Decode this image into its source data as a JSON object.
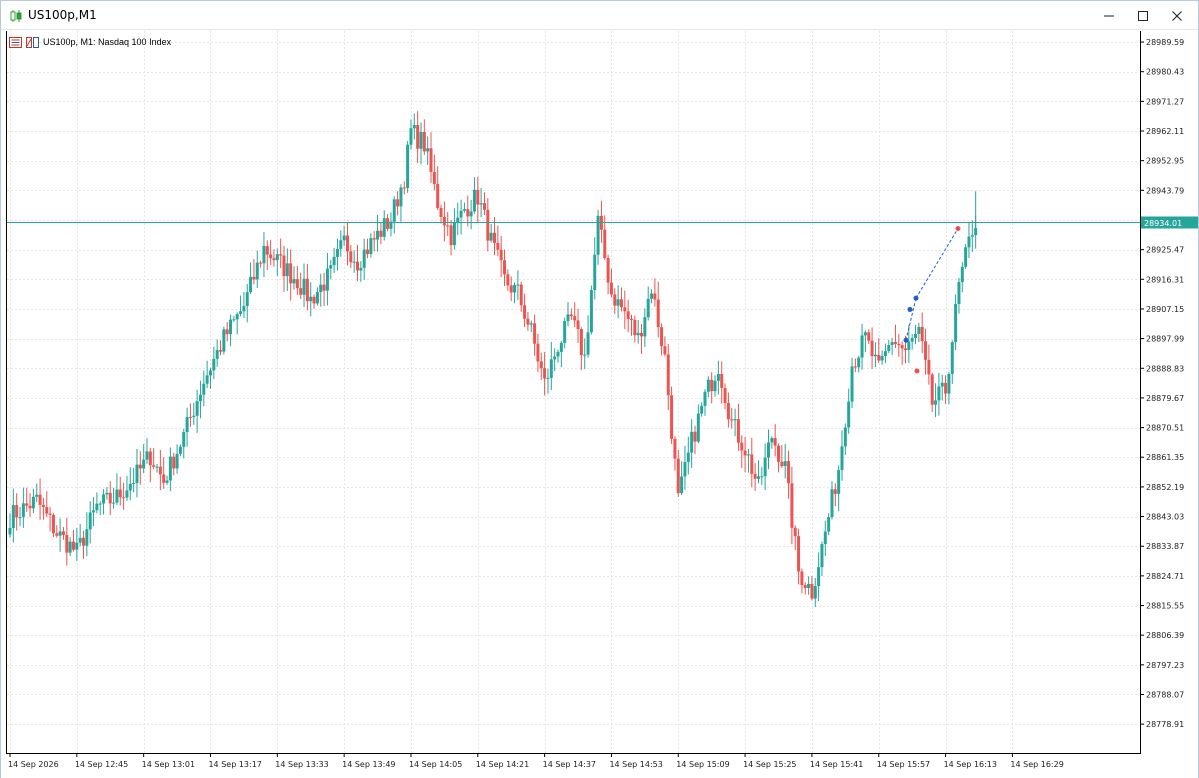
{
  "window": {
    "title": "US100p,M1",
    "icons": [
      "candles-icon",
      "minimize-icon",
      "maximize-icon",
      "close-icon"
    ]
  },
  "chart_header": {
    "label": "US100p, M1:  Nasdaq 100 Index",
    "icons": [
      "indicators-list-icon",
      "chart-type-icon"
    ]
  },
  "colors": {
    "bull": "#26a69a",
    "bear": "#ef5350",
    "grid": "#e6e6e6",
    "bid_line": "#26a69a",
    "trade_line": "#1f5fc8",
    "price_badge_bg": "#26a69a",
    "price_badge_text": "#ffffff"
  },
  "current_price": "28934.01",
  "chart_data": {
    "type": "candlestick",
    "symbol": "US100p",
    "timeframe": "M1",
    "ylim": [
      28770.0,
      28993.0
    ],
    "y_ticks": [
      "28989.59",
      "28980.43",
      "28971.27",
      "28962.11",
      "28952.95",
      "28943.79",
      "28934.63",
      "28925.47",
      "28916.31",
      "28907.15",
      "28897.99",
      "28888.83",
      "28879.67",
      "28870.51",
      "28861.35",
      "28852.19",
      "28843.03",
      "28833.87",
      "28824.71",
      "28815.55",
      "28806.39",
      "28797.23",
      "28788.07",
      "28778.91"
    ],
    "x_ticks": [
      "14 Sep 2026",
      "14 Sep 12:45",
      "14 Sep 13:01",
      "14 Sep 13:17",
      "14 Sep 13:33",
      "14 Sep 13:49",
      "14 Sep 14:05",
      "14 Sep 14:21",
      "14 Sep 14:37",
      "14 Sep 14:53",
      "14 Sep 15:09",
      "14 Sep 15:25",
      "14 Sep 15:41",
      "14 Sep 15:57",
      "14 Sep 16:13",
      "14 Sep 16:29"
    ],
    "anchors": [
      [
        0,
        28843
      ],
      [
        8,
        28848
      ],
      [
        14,
        28838
      ],
      [
        20,
        28832
      ],
      [
        26,
        28846
      ],
      [
        32,
        28849
      ],
      [
        38,
        28856
      ],
      [
        42,
        28862
      ],
      [
        46,
        28854
      ],
      [
        52,
        28868
      ],
      [
        58,
        28885
      ],
      [
        64,
        28898
      ],
      [
        70,
        28908
      ],
      [
        76,
        28926
      ],
      [
        80,
        28922
      ],
      [
        86,
        28916
      ],
      [
        90,
        28910
      ],
      [
        96,
        28918
      ],
      [
        100,
        28928
      ],
      [
        104,
        28922
      ],
      [
        110,
        28930
      ],
      [
        114,
        28935
      ],
      [
        118,
        28948
      ],
      [
        120,
        28962
      ],
      [
        124,
        28958
      ],
      [
        128,
        28940
      ],
      [
        132,
        28930
      ],
      [
        136,
        28938
      ],
      [
        140,
        28942
      ],
      [
        144,
        28928
      ],
      [
        148,
        28916
      ],
      [
        152,
        28912
      ],
      [
        156,
        28900
      ],
      [
        160,
        28884
      ],
      [
        164,
        28896
      ],
      [
        168,
        28904
      ],
      [
        172,
        28892
      ],
      [
        176,
        28934
      ],
      [
        180,
        28912
      ],
      [
        184,
        28906
      ],
      [
        188,
        28898
      ],
      [
        192,
        28914
      ],
      [
        196,
        28892
      ],
      [
        200,
        28848
      ],
      [
        204,
        28866
      ],
      [
        208,
        28880
      ],
      [
        212,
        28890
      ],
      [
        216,
        28872
      ],
      [
        220,
        28864
      ],
      [
        224,
        28852
      ],
      [
        228,
        28868
      ],
      [
        232,
        28858
      ],
      [
        236,
        28826
      ],
      [
        240,
        28820
      ],
      [
        244,
        28838
      ],
      [
        248,
        28858
      ],
      [
        252,
        28890
      ],
      [
        256,
        28898
      ],
      [
        260,
        28888
      ],
      [
        264,
        28898
      ],
      [
        268,
        28894
      ],
      [
        272,
        28900
      ],
      [
        276,
        28878
      ],
      [
        280,
        28882
      ],
      [
        284,
        28914
      ],
      [
        288,
        28932
      ],
      [
        289,
        28934
      ]
    ],
    "trade_markers": [
      {
        "x": 28897.5,
        "label": "buy"
      },
      {
        "x": 28907.0,
        "label": "buy"
      },
      {
        "x": 28910.5,
        "label": "buy"
      },
      {
        "x": 28888.0,
        "label": "sell"
      },
      {
        "x": 28932.0,
        "label": "close"
      }
    ]
  }
}
